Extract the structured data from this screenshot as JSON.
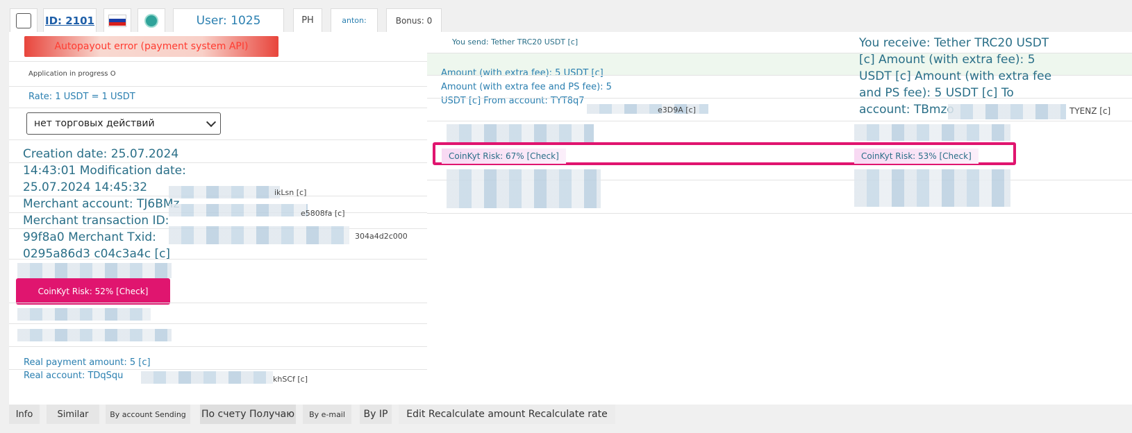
{
  "header": {
    "id_link": "ID: 2101",
    "user": "User: 1025",
    "ph": "PH",
    "operator": "anton:",
    "bonus": "Bonus: 0"
  },
  "left": {
    "error": "Autopayout error (payment system API)",
    "status": "Application in progress O",
    "rate": "Rate: 1 USDT = 1 USDT",
    "select_value": "нет торговых действий",
    "info_lines": [
      "Creation date: 25.07.2024",
      "14:43:01 Modification date:",
      "25.07.2024 14:45:32",
      "Merchant account: TJ6BMz",
      "Merchant transaction ID:",
      "99f8a0 Merchant Txid:",
      "0295a86d3 c04c3a4c [c]"
    ],
    "tails": [
      "ikLsn [c]",
      "e5808fa [c]",
      "304a4d2c000"
    ],
    "risk": "CoinKyt Risk: 52% [Check]",
    "real_amount": "Real payment amount: 5 [c]",
    "real_account": "Real account: TDqSqu",
    "real_account_tail": "khSCf [c]"
  },
  "mid": {
    "send": "You send: Tether TRC20 USDT [c]",
    "amount_lines": [
      "Amount (with extra fee): 5 USDT [c]",
      "Amount (with extra fee and PS fee): 5",
      "USDT [c] From account: TYT8q7"
    ],
    "tail": "e3D9A [c]",
    "risk": "CoinKyt Risk: 67% [Check]"
  },
  "right": {
    "lines": [
      "You receive: Tether TRC20 USDT",
      "[c] Amount (with extra fee): 5",
      "USDT [c] Amount (with extra fee",
      "and PS fee): 5 USDT [c] To",
      "account: TBmzo"
    ],
    "tail": "TYENZ [c]",
    "risk": "CoinKyt Risk: 53% [Check]"
  },
  "tabs": [
    "Info",
    "Similar",
    "By account Sending",
    "По счету Получаю",
    "By e-mail",
    "By IP",
    "Edit Recalculate amount Recalculate rate"
  ],
  "colors": {
    "accent_pink": "#e0156f",
    "text_teal": "#2a6f88",
    "link_blue": "#1f5fa8",
    "error_red": "#e8453c"
  }
}
